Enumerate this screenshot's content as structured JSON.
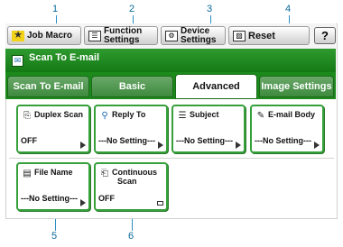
{
  "callouts": [
    "1",
    "2",
    "3",
    "4",
    "5",
    "6"
  ],
  "toolbar": {
    "job_macro": "Job Macro",
    "function_settings": [
      "Function",
      "Settings"
    ],
    "device_settings": [
      "Device",
      "Settings"
    ],
    "reset": "Reset",
    "help": "?"
  },
  "title": "Scan To E-mail",
  "tabs": [
    "Scan To E-mail",
    "Basic",
    "Advanced",
    "Image Settings"
  ],
  "active_tab": "Advanced",
  "settings": [
    {
      "title": "Duplex Scan",
      "value": "OFF"
    },
    {
      "title": "Reply To",
      "value": "---No Setting---"
    },
    {
      "title": "Subject",
      "value": "---No Setting---"
    },
    {
      "title": "E-mail Body",
      "value": "---No Setting---"
    },
    {
      "title": "File Name",
      "value": "---No Setting---"
    },
    {
      "title": [
        "Continuous",
        "Scan"
      ],
      "value": "OFF"
    }
  ],
  "colors": {
    "accent_green": "#1b8a1b",
    "callout_blue": "#2a8fc0"
  }
}
